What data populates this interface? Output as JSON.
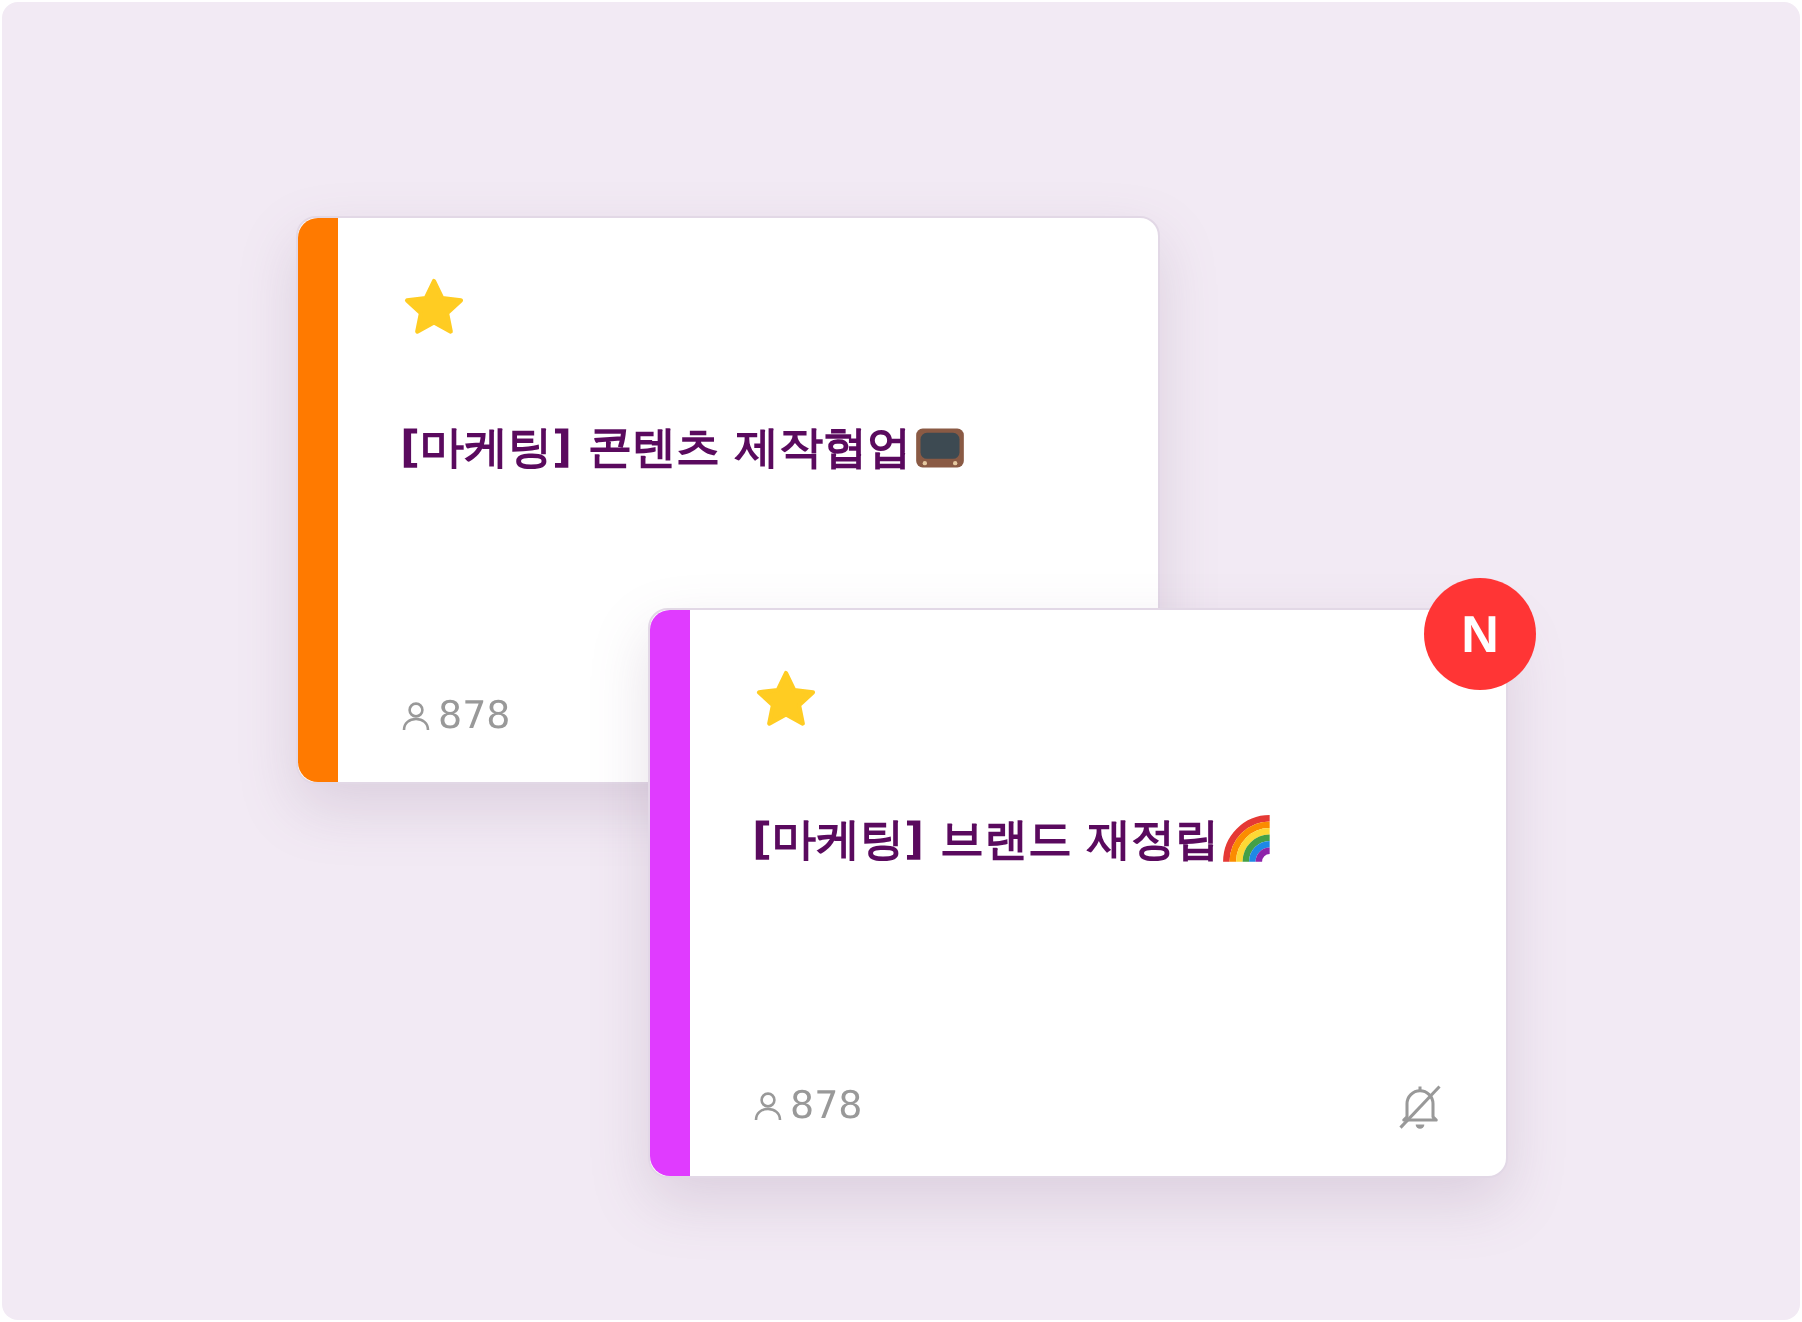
{
  "cards": [
    {
      "color": "#ff7a00",
      "starred": true,
      "title": "[마케팅] 콘텐츠 제작협업",
      "members": "878"
    },
    {
      "color": "#e03bff",
      "starred": true,
      "title": "[마케팅] 브랜드 재정립",
      "members": "878",
      "badge": "N",
      "muted": true
    }
  ]
}
